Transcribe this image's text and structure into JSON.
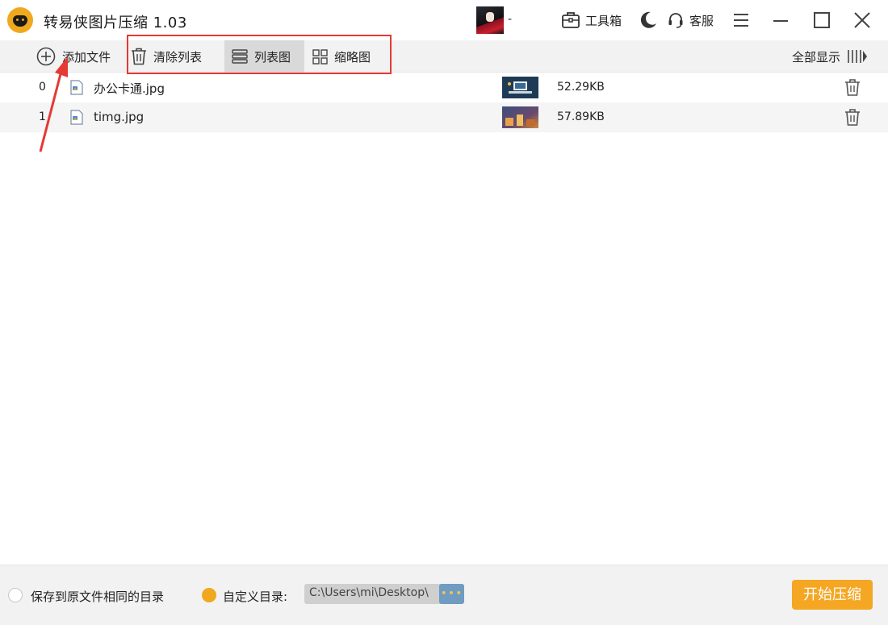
{
  "app": {
    "title": "转易侠图片压缩 1.03",
    "username": "-"
  },
  "header": {
    "toolbox_label": "工具箱",
    "service_label": "客服"
  },
  "toolbar": {
    "add_file": "添加文件",
    "clear_list": "清除列表",
    "list_view": "列表图",
    "thumbnail_view": "缩略图",
    "show_all": "全部显示"
  },
  "files": [
    {
      "index": "0",
      "name": "办公卡通.jpg",
      "size": "52.29KB"
    },
    {
      "index": "1",
      "name": "timg.jpg",
      "size": "57.89KB"
    }
  ],
  "footer": {
    "save_same_dir": "保存到原文件相同的目录",
    "custom_dir_label": "自定义目录:",
    "custom_dir_path": "C:\\Users\\mi\\Desktop\\",
    "browse_label": "•••",
    "start_button": "开始压缩"
  },
  "colors": {
    "accent": "#f5a623",
    "highlight": "#e53935",
    "browse": "#6f9cc0"
  }
}
